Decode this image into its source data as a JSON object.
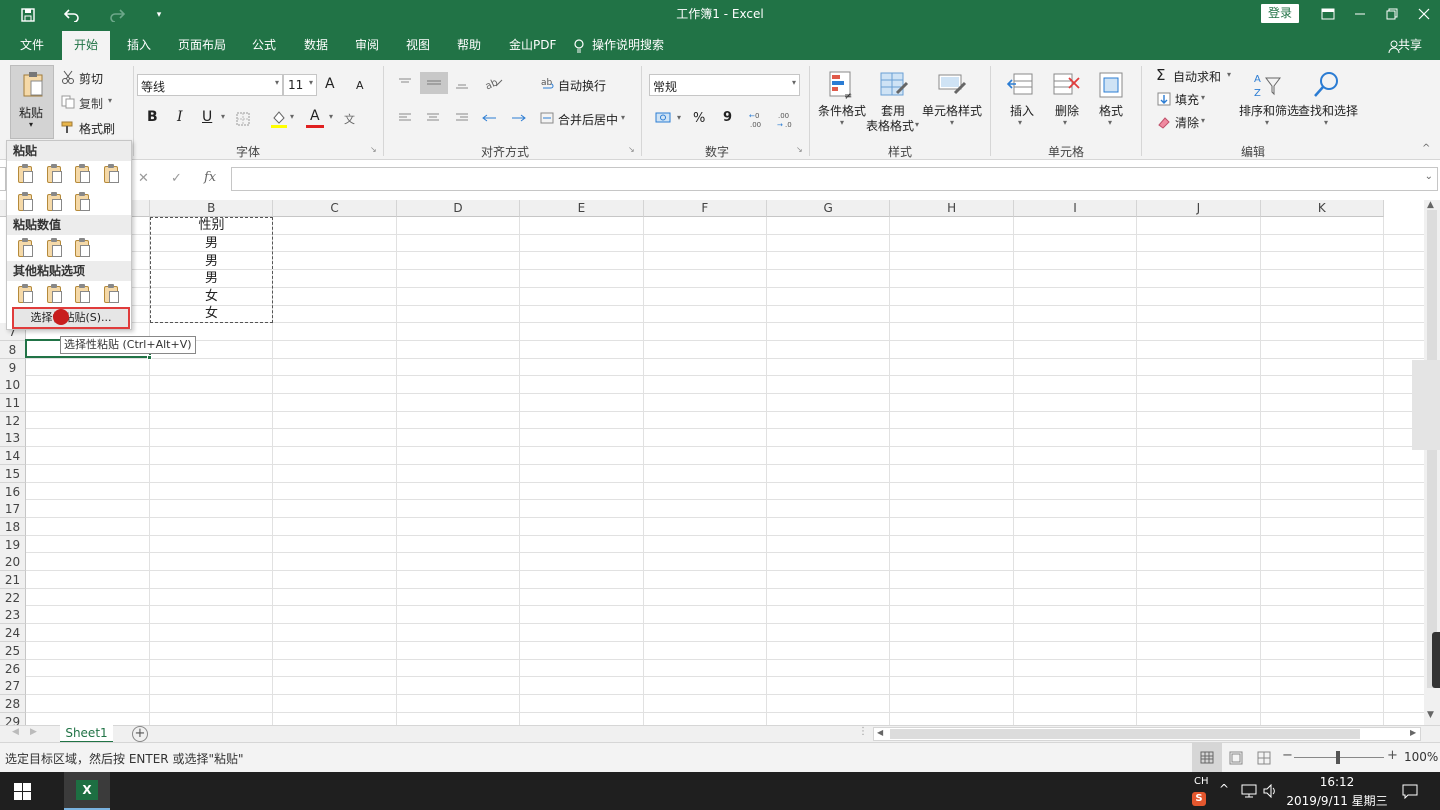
{
  "window": {
    "title": "工作簿1  -  Excel",
    "login_label": "登录"
  },
  "tabs": [
    "文件",
    "开始",
    "插入",
    "页面布局",
    "公式",
    "数据",
    "审阅",
    "视图",
    "帮助",
    "金山PDF"
  ],
  "tell_me": "操作说明搜索",
  "share_label": "共享",
  "ribbon": {
    "clipboard": {
      "paste": "粘贴",
      "cut": "剪切",
      "copy": "复制",
      "format_painter": "格式刷"
    },
    "font": {
      "name": "等线",
      "size": "11",
      "label": "字体",
      "bold": "B",
      "italic": "I",
      "underline": "U",
      "font_color_letter": "A",
      "grow": "A",
      "shrink": "A",
      "phonetic": "文"
    },
    "alignment": {
      "wrap": "自动换行",
      "merge": "合并后居中",
      "label": "对齐方式"
    },
    "number": {
      "format": "常规",
      "label": "数字",
      "percent": "%",
      "comma": "9"
    },
    "styles": {
      "conditional": "条件格式",
      "table_line1": "套用",
      "table_line2": "表格格式",
      "cell_styles": "单元格样式",
      "label": "样式"
    },
    "cells": {
      "insert": "插入",
      "delete": "删除",
      "format": "格式",
      "label": "单元格"
    },
    "editing": {
      "autosum": "自动求和",
      "fill": "填充",
      "clear": "清除",
      "sort_filter": "排序和筛选",
      "find_select": "查找和选择",
      "label": "编辑"
    }
  },
  "formula_bar": {
    "cancel": "✕",
    "enter": "✓",
    "fx": "fx"
  },
  "columns": [
    "B",
    "C",
    "D",
    "E",
    "F",
    "G",
    "H",
    "I",
    "J",
    "K"
  ],
  "rows": [
    "7",
    "8",
    "9",
    "10",
    "11",
    "12",
    "13",
    "14",
    "15",
    "16",
    "17",
    "18",
    "19",
    "20",
    "21",
    "22",
    "23",
    "24",
    "25",
    "26",
    "27",
    "28",
    "29"
  ],
  "cells": {
    "header": "性别",
    "values": [
      "男",
      "男",
      "男",
      "女",
      "女"
    ]
  },
  "paste_menu": {
    "section1": "粘贴",
    "section2": "粘贴数值",
    "section3": "其他粘贴选项",
    "paste_special": "选择性粘贴(S)...",
    "tooltip": "选择性粘贴 (Ctrl+Alt+V)"
  },
  "sheet_tab": "Sheet1",
  "status_text": "选定目标区域，然后按 ENTER 或选择\"粘贴\"",
  "zoom": "100%",
  "taskbar": {
    "ime": "CH",
    "time": "16:12",
    "date": "2019/9/11 星期三",
    "excel_letter": "X"
  },
  "colors": {
    "excel_green": "#217346",
    "highlight_red": "#e03c3c"
  }
}
